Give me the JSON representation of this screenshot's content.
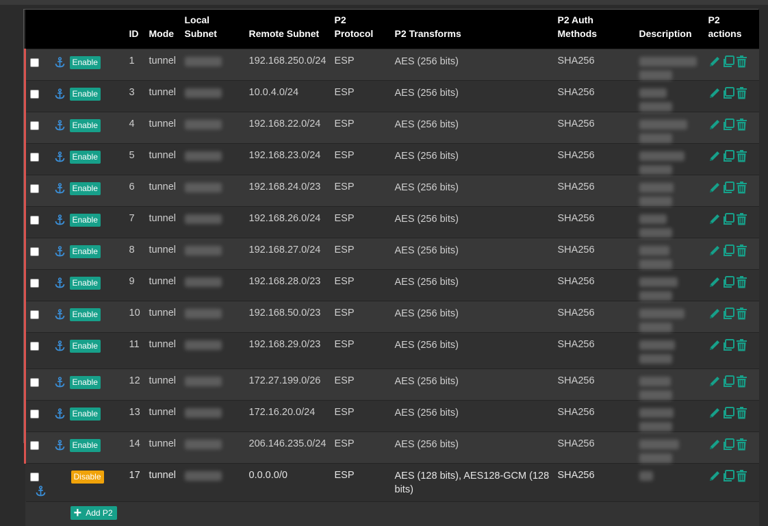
{
  "headers": {
    "id": "ID",
    "mode": "Mode",
    "local_subnet": [
      "Local",
      "Subnet"
    ],
    "remote_subnet": "Remote Subnet",
    "protocol": [
      "P2",
      "Protocol"
    ],
    "transforms": "P2 Transforms",
    "auth": [
      "P2 Auth",
      "Methods"
    ],
    "description": "Description",
    "actions": [
      "P2",
      "actions"
    ]
  },
  "rows": [
    {
      "status": "Enable",
      "id": "1",
      "mode": "tunnel",
      "remote": "192.168.250.0/24",
      "protocol": "ESP",
      "transforms": "AES (256 bits)",
      "auth": "SHA256"
    },
    {
      "status": "Enable",
      "id": "3",
      "mode": "tunnel",
      "remote": "10.0.4.0/24",
      "protocol": "ESP",
      "transforms": "AES (256 bits)",
      "auth": "SHA256"
    },
    {
      "status": "Enable",
      "id": "4",
      "mode": "tunnel",
      "remote": "192.168.22.0/24",
      "protocol": "ESP",
      "transforms": "AES (256 bits)",
      "auth": "SHA256"
    },
    {
      "status": "Enable",
      "id": "5",
      "mode": "tunnel",
      "remote": "192.168.23.0/24",
      "protocol": "ESP",
      "transforms": "AES (256 bits)",
      "auth": "SHA256"
    },
    {
      "status": "Enable",
      "id": "6",
      "mode": "tunnel",
      "remote": "192.168.24.0/23",
      "protocol": "ESP",
      "transforms": "AES (256 bits)",
      "auth": "SHA256"
    },
    {
      "status": "Enable",
      "id": "7",
      "mode": "tunnel",
      "remote": "192.168.26.0/24",
      "protocol": "ESP",
      "transforms": "AES (256 bits)",
      "auth": "SHA256"
    },
    {
      "status": "Enable",
      "id": "8",
      "mode": "tunnel",
      "remote": "192.168.27.0/24",
      "protocol": "ESP",
      "transforms": "AES (256 bits)",
      "auth": "SHA256"
    },
    {
      "status": "Enable",
      "id": "9",
      "mode": "tunnel",
      "remote": "192.168.28.0/23",
      "protocol": "ESP",
      "transforms": "AES (256 bits)",
      "auth": "SHA256"
    },
    {
      "status": "Enable",
      "id": "10",
      "mode": "tunnel",
      "remote": "192.168.50.0/23",
      "protocol": "ESP",
      "transforms": "AES (256 bits)",
      "auth": "SHA256"
    },
    {
      "status": "Enable",
      "id": "11",
      "mode": "tunnel",
      "remote": "192.168.29.0/23",
      "protocol": "ESP",
      "transforms": "AES (256 bits)",
      "auth": "SHA256"
    },
    {
      "status": "Enable",
      "id": "12",
      "mode": "tunnel",
      "remote": "172.27.199.0/26",
      "protocol": "ESP",
      "transforms": "AES (256 bits)",
      "auth": "SHA256"
    },
    {
      "status": "Enable",
      "id": "13",
      "mode": "tunnel",
      "remote": "172.16.20.0/24",
      "protocol": "ESP",
      "transforms": "AES (256 bits)",
      "auth": "SHA256"
    },
    {
      "status": "Enable",
      "id": "14",
      "mode": "tunnel",
      "remote": "206.146.235.0/24",
      "protocol": "ESP",
      "transforms": "AES (256 bits)",
      "auth": "SHA256"
    }
  ],
  "disabled_row": {
    "status": "Disable",
    "id": "17",
    "mode": "tunnel",
    "remote": "0.0.0.0/0",
    "protocol": "ESP",
    "transforms": "AES (128 bits), AES128-GCM (128 bits)",
    "auth": "SHA256"
  },
  "add_button": "Add P2",
  "colors": {
    "enable": "#17a08a",
    "disable": "#f0a30a",
    "edge": "#d9534f",
    "icons": "#17a08a",
    "anchor": "#3a8fd8"
  },
  "icons": [
    "anchor-icon",
    "pencil-icon",
    "copy-icon",
    "trash-icon",
    "plus-icon"
  ]
}
